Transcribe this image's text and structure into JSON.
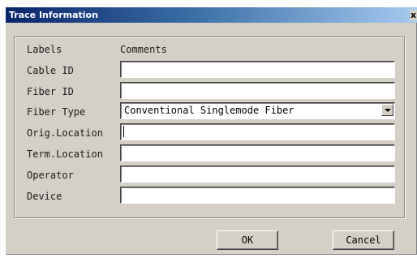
{
  "window": {
    "title": "Trace Information",
    "close_label": "x"
  },
  "headers": {
    "labels": "Labels",
    "comments": "Comments"
  },
  "fields": {
    "cable_id": {
      "label": "Cable ID",
      "value": ""
    },
    "fiber_id": {
      "label": "Fiber ID",
      "value": ""
    },
    "fiber_type": {
      "label": "Fiber Type",
      "value": "Conventional Singlemode Fiber"
    },
    "orig_location": {
      "label": "Orig.Location",
      "value": ""
    },
    "term_location": {
      "label": "Term.Location",
      "value": ""
    },
    "operator": {
      "label": "Operator",
      "value": ""
    },
    "device": {
      "label": "Device",
      "value": ""
    }
  },
  "buttons": {
    "ok": "OK",
    "cancel": "Cancel"
  },
  "icons": {
    "close": "close-icon",
    "dropdown": "chevron-down-icon"
  },
  "colors": {
    "title_bar_start": "#0a246a",
    "title_bar_end": "#a6caf0",
    "dialog_face": "#d4d0c8"
  }
}
